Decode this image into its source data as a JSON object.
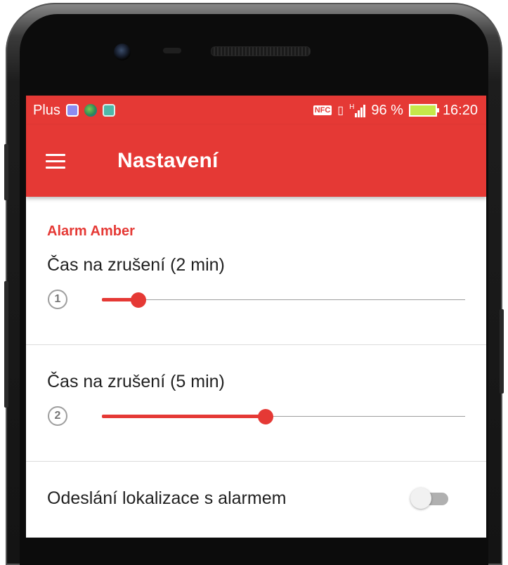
{
  "status_bar": {
    "carrier": "Plus",
    "nfc": "NFC",
    "network": "H",
    "battery": "96 %",
    "time": "16:20"
  },
  "app_bar": {
    "title": "Nastavení"
  },
  "section": {
    "title": "Alarm Amber"
  },
  "settings": [
    {
      "title": "Čas na zrušení (2 min)",
      "step": "1",
      "level": 0.1
    },
    {
      "title": "Čas na zrušení (5 min)",
      "step": "2",
      "level": 0.45
    }
  ],
  "location_toggle": {
    "label": "Odeslání lokalizace s alarmem",
    "on": false
  },
  "colors": {
    "accent": "#e53935"
  },
  "icons": [
    "menu-icon",
    "vpn-icon",
    "globe-icon",
    "android-icon",
    "nfc-icon",
    "vibrate-icon",
    "signal-icon",
    "battery-icon"
  ]
}
